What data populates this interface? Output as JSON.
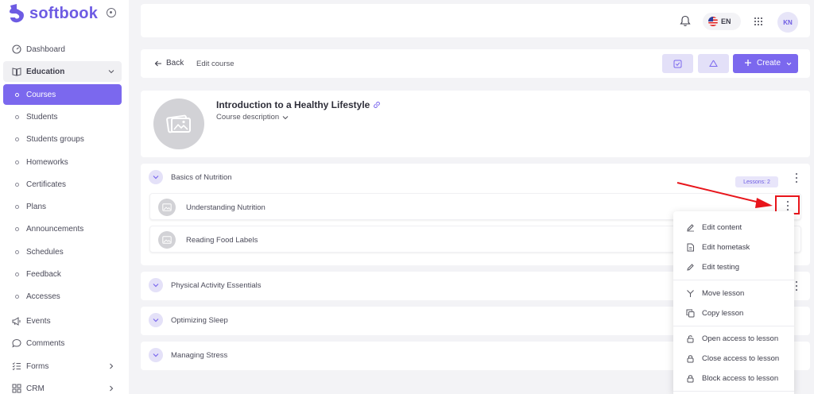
{
  "brand": {
    "name": "softbook"
  },
  "sidebar": {
    "items": [
      {
        "label": "Dashboard"
      },
      {
        "label": "Education"
      },
      {
        "label": "Courses"
      },
      {
        "label": "Students"
      },
      {
        "label": "Students groups"
      },
      {
        "label": "Homeworks"
      },
      {
        "label": "Certificates"
      },
      {
        "label": "Plans"
      },
      {
        "label": "Announcements"
      },
      {
        "label": "Schedules"
      },
      {
        "label": "Feedback"
      },
      {
        "label": "Accesses"
      },
      {
        "label": "Events"
      },
      {
        "label": "Comments"
      },
      {
        "label": "Forms"
      },
      {
        "label": "CRM"
      }
    ]
  },
  "header": {
    "language": "EN",
    "avatar_initials": "KN"
  },
  "toolbar": {
    "back_label": "Back",
    "breadcrumb": "Edit course",
    "create_label": "Create"
  },
  "course": {
    "title": "Introduction to a Healthy Lifestyle",
    "description_label": "Course description"
  },
  "modules": [
    {
      "title": "Basics of Nutrition",
      "lessons_badge": "Lessons: 2",
      "lessons": [
        {
          "title": "Understanding Nutrition"
        },
        {
          "title": "Reading Food Labels"
        }
      ]
    },
    {
      "title": "Physical Activity Essentials"
    },
    {
      "title": "Optimizing Sleep"
    },
    {
      "title": "Managing Stress"
    }
  ],
  "context_menu": {
    "items": [
      {
        "label": "Edit content",
        "icon": "pencil-icon"
      },
      {
        "label": "Edit hometask",
        "icon": "document-icon"
      },
      {
        "label": "Edit testing",
        "icon": "pencil-icon"
      },
      {
        "label": "Move lesson",
        "icon": "move-icon"
      },
      {
        "label": "Copy lesson",
        "icon": "copy-icon"
      },
      {
        "label": "Open access to lesson",
        "icon": "unlock-icon"
      },
      {
        "label": "Close access to lesson",
        "icon": "lock-icon"
      },
      {
        "label": "Block access to lesson",
        "icon": "lock-icon"
      }
    ]
  },
  "colors": {
    "accent": "#7b68ee",
    "highlight": "#e8151b"
  }
}
